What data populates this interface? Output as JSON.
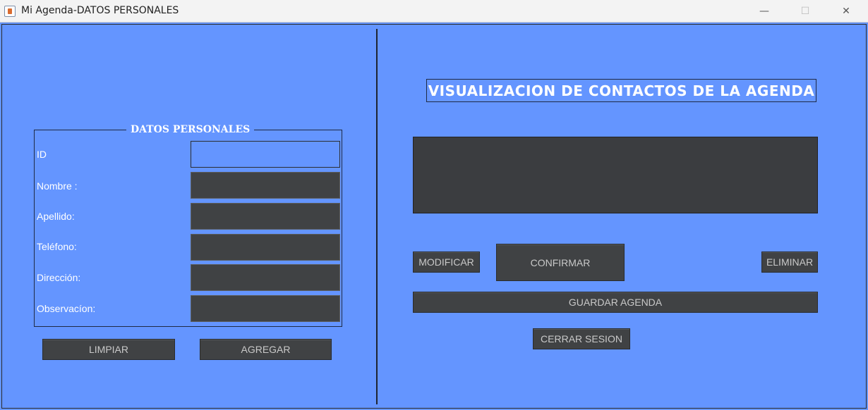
{
  "window": {
    "title": "Mi Agenda-DATOS PERSONALES",
    "minimize": "—",
    "maximize": "☐",
    "close": "✕"
  },
  "form": {
    "group_title": "DATOS PERSONALES",
    "fields": [
      {
        "label": "ID",
        "value": ""
      },
      {
        "label": "Nombre :",
        "value": ""
      },
      {
        "label": "Apellido:",
        "value": ""
      },
      {
        "label": "Teléfono:",
        "value": ""
      },
      {
        "label": "Dirección:",
        "value": ""
      },
      {
        "label": "Observacíon:",
        "value": ""
      }
    ],
    "clear_label": "LIMPIAR",
    "add_label": "AGREGAR"
  },
  "agenda": {
    "title": "VISUALIZACION DE CONTACTOS DE LA AGENDA",
    "contacts_text": "",
    "modify_label": "MODIFICAR",
    "confirm_label": "CONFIRMAR",
    "delete_label": "ELIMINAR",
    "save_label": "GUARDAR AGENDA",
    "logout_label": "CERRAR SESION"
  },
  "colors": {
    "background": "#6495ff",
    "button": "#404244",
    "text_field": "#404244"
  }
}
